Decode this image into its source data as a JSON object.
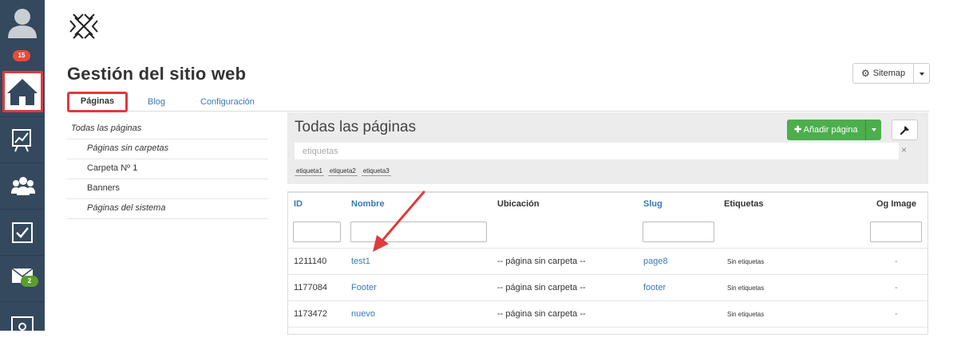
{
  "sidebar": {
    "notifications_badge": "15",
    "messages_badge": "2"
  },
  "header": {
    "title": "Gestión del sitio web",
    "sitemap_label": "Sitemap"
  },
  "tabs": [
    {
      "label": "Páginas",
      "active": true
    },
    {
      "label": "Blog",
      "active": false
    },
    {
      "label": "Configuración",
      "active": false
    }
  ],
  "folders": [
    {
      "label": "Todas las páginas"
    },
    {
      "label": "Páginas sin carpetas"
    },
    {
      "label": "Carpeta Nº 1"
    },
    {
      "label": "Banners"
    },
    {
      "label": "Páginas del sistema"
    }
  ],
  "panel": {
    "title": "Todas las páginas",
    "add_label": "Añadir página",
    "tags_placeholder": "etiquetas",
    "clear_label": "×",
    "tags": [
      "etiqueta1",
      "etiqueta2",
      "etiqueta3"
    ]
  },
  "table": {
    "headers": {
      "id": "ID",
      "name": "Nombre",
      "location": "Ubicación",
      "slug": "Slug",
      "tags": "Etiquetas",
      "og": "Og Image"
    },
    "rows": [
      {
        "id": "1211140",
        "name": "test1",
        "location": "-- página sin carpeta --",
        "slug": "page8",
        "tags": "Sin etiquetas",
        "og": "-"
      },
      {
        "id": "1177084",
        "name": "Footer",
        "location": "-- página sin carpeta --",
        "slug": "footer",
        "tags": "Sin etiquetas",
        "og": "-"
      },
      {
        "id": "1173472",
        "name": "nuevo",
        "location": "-- página sin carpeta --",
        "slug": "",
        "tags": "Sin etiquetas",
        "og": "-"
      }
    ]
  },
  "colors": {
    "sidebar": "#34495e",
    "highlight": "#e03a3a",
    "link": "#3a79b8",
    "success": "#4cae4c"
  }
}
